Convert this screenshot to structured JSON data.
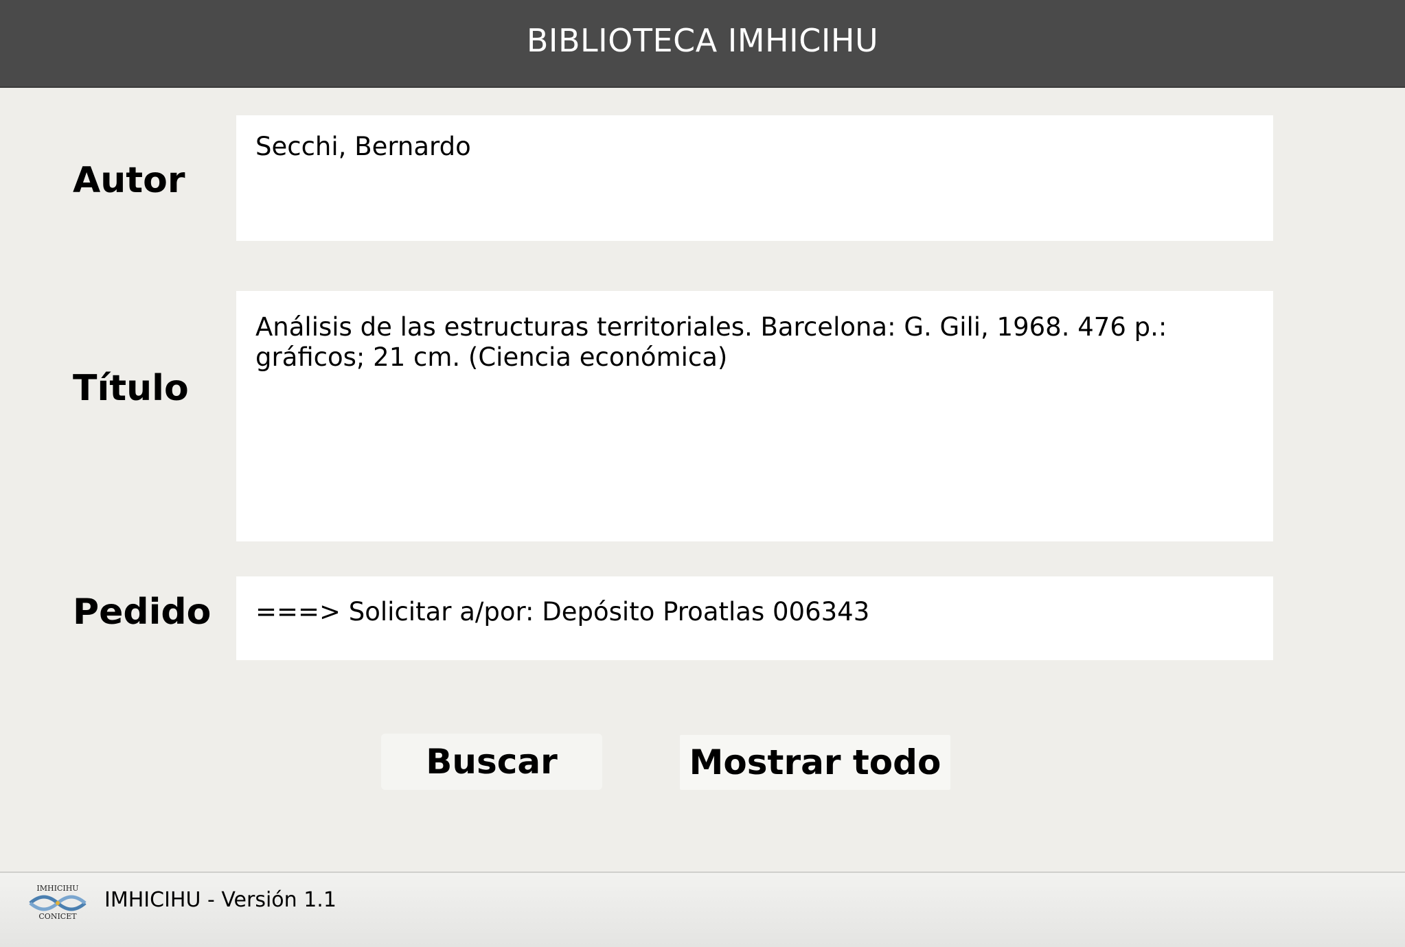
{
  "header": {
    "title": "BIBLIOTECA IMHICIHU"
  },
  "fields": {
    "autor": {
      "label": "Autor",
      "value": "Secchi, Bernardo"
    },
    "titulo": {
      "label": "Título",
      "value": "Análisis de las estructuras territoriales. Barcelona: G. Gili, 1968. 476 p.: gráficos; 21 cm. (Ciencia económica)"
    },
    "pedido": {
      "label": "Pedido",
      "value": "===> Solicitar a/por: Depósito Proatlas 006343"
    }
  },
  "buttons": {
    "buscar": "Buscar",
    "mostrar_todo": "Mostrar todo"
  },
  "footer": {
    "logo_top": "IMHICIHU",
    "logo_bottom": "CONICET",
    "version_text": "IMHICIHU - Versión 1.1"
  },
  "colors": {
    "header_bg": "#4a4a4a",
    "page_bg": "#efeeea",
    "field_bg": "#ffffff",
    "logo_blue": "#4a7fb0"
  }
}
